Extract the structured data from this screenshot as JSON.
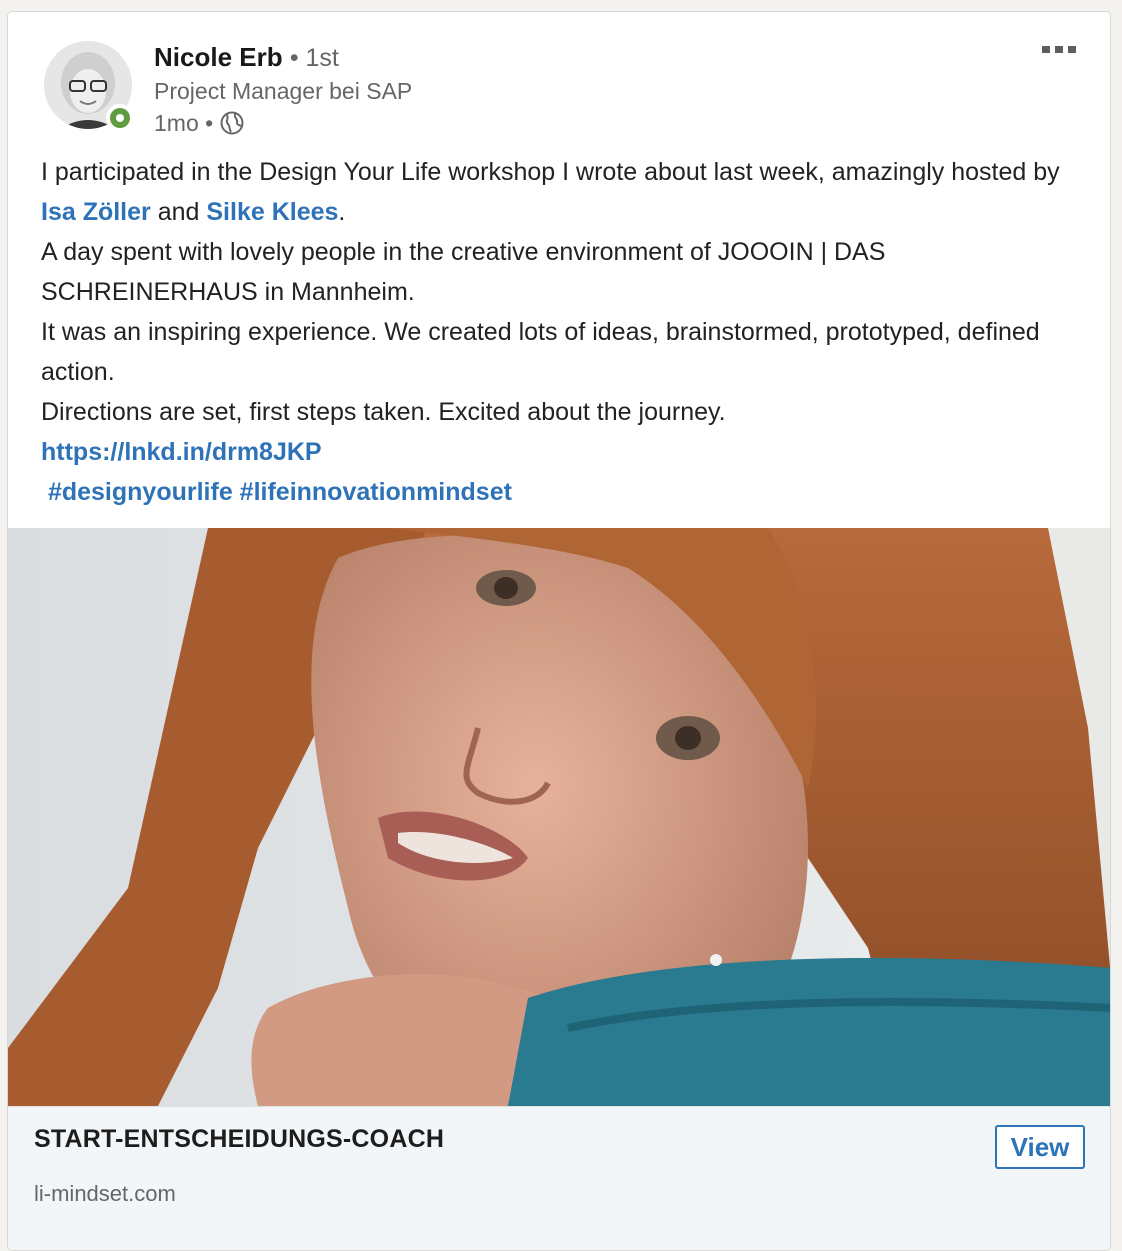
{
  "post": {
    "author": {
      "name": "Nicole Erb",
      "degree": "• 1st",
      "headline": "Project Manager bei SAP",
      "time": "1mo •",
      "visibility_icon": "globe-icon",
      "online_status": "online"
    },
    "menu_icon": "more-horizontal-icon",
    "text": {
      "line1_prefix": "I participated in the Design Your Life workshop I wrote about last week, amazingly hosted by ",
      "mention1": "Isa Zöller",
      "and": " and ",
      "mention2": "Silke Klees",
      "line1_suffix": ".",
      "para2": "A day spent with lovely people in the creative environment of JOOOIN | DAS SCHREINERHAUS in Mannheim.",
      "para3": "It was an inspiring experience. We created lots of ideas, brainstormed, prototyped, defined action.",
      "para4": "Directions are set, first steps taken. Excited about the journey.",
      "link": "https://lnkd.in/drm8JKP",
      "hashtag1": "#designyourlife",
      "hashtag2": "#lifeinnovationmindset"
    },
    "link_preview": {
      "title": "START-ENTSCHEIDUNGS-COACH",
      "domain": "li-mindset.com",
      "button": "View"
    }
  },
  "colors": {
    "link_blue": "#0a66c2",
    "mention_blue": "#2e72b7",
    "online_green": "#5f9b41"
  }
}
